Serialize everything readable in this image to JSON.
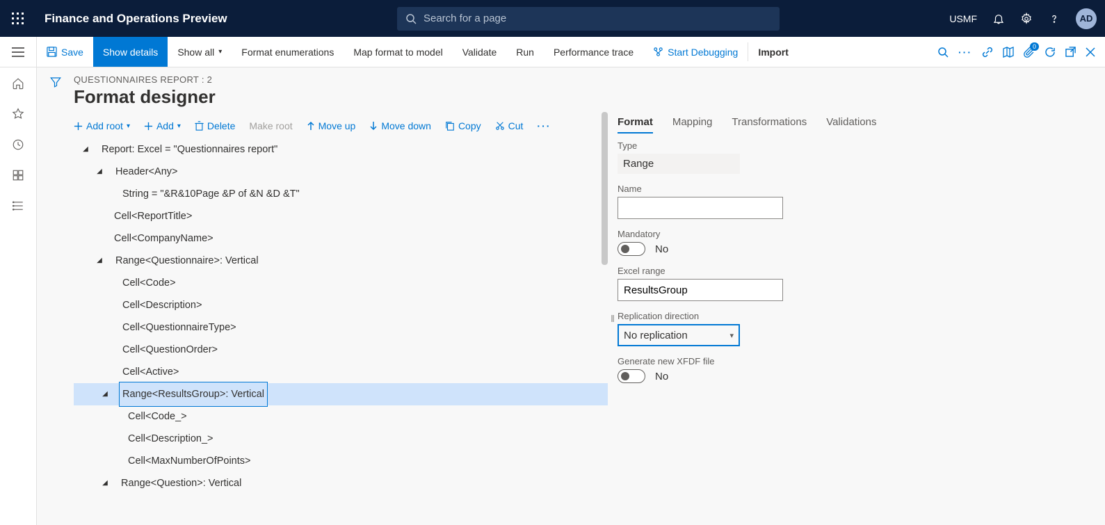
{
  "topbar": {
    "brand": "Finance and Operations Preview",
    "search_placeholder": "Search for a page",
    "company": "USMF",
    "avatar_initials": "AD"
  },
  "cmdbar": {
    "save": "Save",
    "show_details": "Show details",
    "show_all": "Show all",
    "format_enum": "Format enumerations",
    "map_format": "Map format to model",
    "validate": "Validate",
    "run": "Run",
    "perf_trace": "Performance trace",
    "start_debug": "Start Debugging",
    "import": "Import"
  },
  "page": {
    "breadcrumb": "QUESTIONNAIRES REPORT : 2",
    "title": "Format designer"
  },
  "subcmd": {
    "add_root": "Add root",
    "add": "Add",
    "delete": "Delete",
    "make_root": "Make root",
    "move_up": "Move up",
    "move_down": "Move down",
    "copy": "Copy",
    "cut": "Cut"
  },
  "tree": {
    "n0": "Report: Excel = \"Questionnaires report\"",
    "n1": "Header<Any>",
    "n2": "String = \"&R&10Page &P of &N &D &T\"",
    "n3": "Cell<ReportTitle>",
    "n4": "Cell<CompanyName>",
    "n5": "Range<Questionnaire>: Vertical",
    "n6": "Cell<Code>",
    "n7": "Cell<Description>",
    "n8": "Cell<QuestionnaireType>",
    "n9": "Cell<QuestionOrder>",
    "n10": "Cell<Active>",
    "n11": "Range<ResultsGroup>: Vertical",
    "n12": "Cell<Code_>",
    "n13": "Cell<Description_>",
    "n14": "Cell<MaxNumberOfPoints>",
    "n15": "Range<Question>: Vertical"
  },
  "tabs": {
    "format": "Format",
    "mapping": "Mapping",
    "transformations": "Transformations",
    "validations": "Validations"
  },
  "props": {
    "type_label": "Type",
    "type_value": "Range",
    "name_label": "Name",
    "name_value": "",
    "mandatory_label": "Mandatory",
    "mandatory_value": "No",
    "excel_range_label": "Excel range",
    "excel_range_value": "ResultsGroup",
    "repl_dir_label": "Replication direction",
    "repl_dir_value": "No replication",
    "xfdf_label": "Generate new XFDF file",
    "xfdf_value": "No"
  },
  "attach_badge": "0"
}
